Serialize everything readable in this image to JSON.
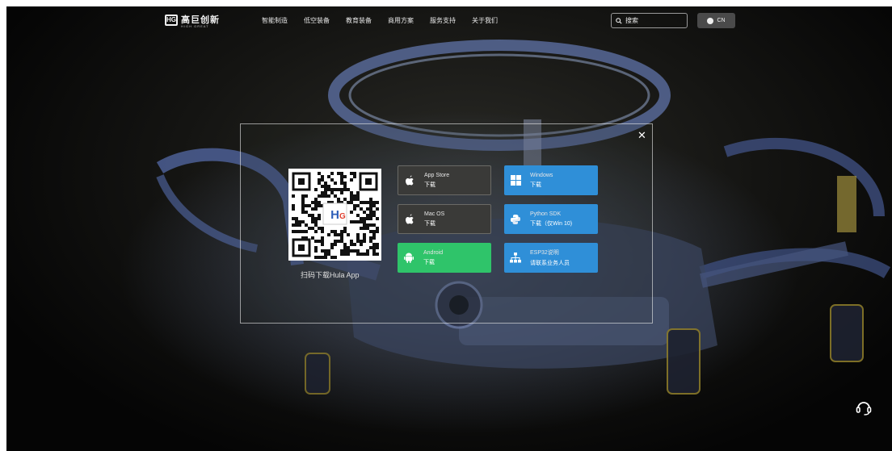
{
  "header": {
    "logo_text": "高巨创新",
    "logo_sub": "HIGH GREAT",
    "nav": [
      "智能制造",
      "低空装备",
      "教育装备",
      "商用方案",
      "服务支持",
      "关于我们"
    ],
    "search_placeholder": "搜索",
    "lang_label": "CN"
  },
  "modal": {
    "close_label": "✕",
    "qr_caption": "扫码下载Hula App",
    "buttons": [
      {
        "title": "App Store",
        "action": "下载",
        "icon": "apple-icon",
        "color": "gray"
      },
      {
        "title": "Windows",
        "action": "下载",
        "icon": "windows-icon",
        "color": "#2f8fd8"
      },
      {
        "title": "Mac OS",
        "action": "下载",
        "icon": "apple-icon",
        "color": "gray"
      },
      {
        "title": "Python SDK",
        "action": "下载（仅Win 10)",
        "icon": "python-icon",
        "color": "#2f8fd8"
      },
      {
        "title": "Android",
        "action": "下载",
        "icon": "android-icon",
        "color": "#2fc46a"
      },
      {
        "title": "ESP32说明",
        "action": "请联系业务人员",
        "icon": "network-icon",
        "color": "#2f8fd8"
      }
    ]
  },
  "support_icon": "headset-icon"
}
